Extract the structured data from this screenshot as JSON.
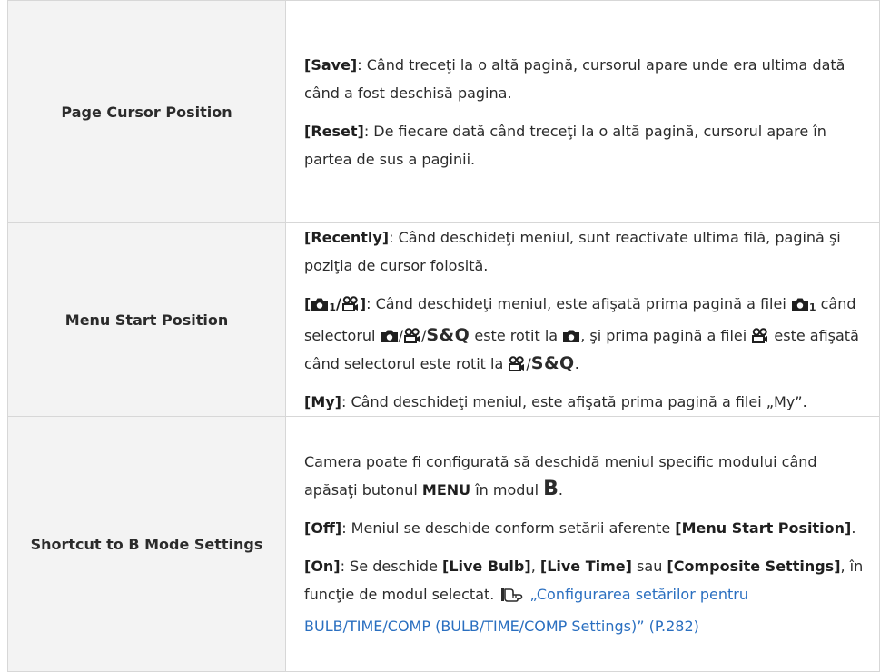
{
  "rows": [
    {
      "label": "Page Cursor Position",
      "save_key": "[Save]",
      "save_text": ": Când treceţi la o altă pagină, cursorul apare unde era ultima dată când a fost deschisă pagina.",
      "reset_key": "[Reset]",
      "reset_text": ": De fiecare dată când treceţi la o altă pagină, cursorul apare în partea de sus a paginii."
    },
    {
      "label": "Menu Start Position",
      "recently_key": "[Recently]",
      "recently_text": ": Când deschideţi meniul, sunt reactivate ultima filă, pagină şi poziţia de cursor folosită.",
      "mode_key_open": "[",
      "mode_key_sub": "1",
      "mode_key_slash": "/",
      "mode_key_close": "]",
      "mode_text_1": ": Când deschideţi meniul, este afişată prima pagină a filei",
      "mode_text_2": "când selectorul",
      "mode_text_3": "este rotit la",
      "mode_text_4": ", şi prima pagină a filei",
      "mode_text_5": "este afişată când selectorul este rotit la",
      "sq_label": "S&Q",
      "slash": "/",
      "period": ".",
      "my_key": "[My]",
      "my_text": ": Când deschideţi meniul, este afişată prima pagină a filei „My”."
    },
    {
      "label": "Shortcut to B Mode Settings",
      "intro_1": "Camera poate fi configurată să deschidă meniul specific modului când apăsaţi butonul",
      "menu_word": "MENU",
      "intro_2": "în modul",
      "b_letter": "B",
      "period": ".",
      "off_key": "[Off]",
      "off_text": ": Meniul se deschide conform setării aferente",
      "off_ref": "[Menu Start Position]",
      "on_key": "[On]",
      "on_text_1": ": Se deschide",
      "live_bulb": "[Live Bulb]",
      "comma": ",",
      "live_time": "[Live Time]",
      "or_word": "sau",
      "composite": "[Composite Settings]",
      "on_text_2": ", în funcţie de modul selectat.",
      "link_text": "„Configurarea setărilor pentru BULB/TIME/COMP (BULB/TIME/COMP Settings)” (P.282)"
    }
  ],
  "icons": [
    "camera-icon",
    "movie-icon",
    "reference-icon"
  ],
  "colors": {
    "label_bg": "#f3f3f3",
    "border": "#d7d7d7",
    "link": "#2a6fc0",
    "text": "#2b2b2b"
  }
}
